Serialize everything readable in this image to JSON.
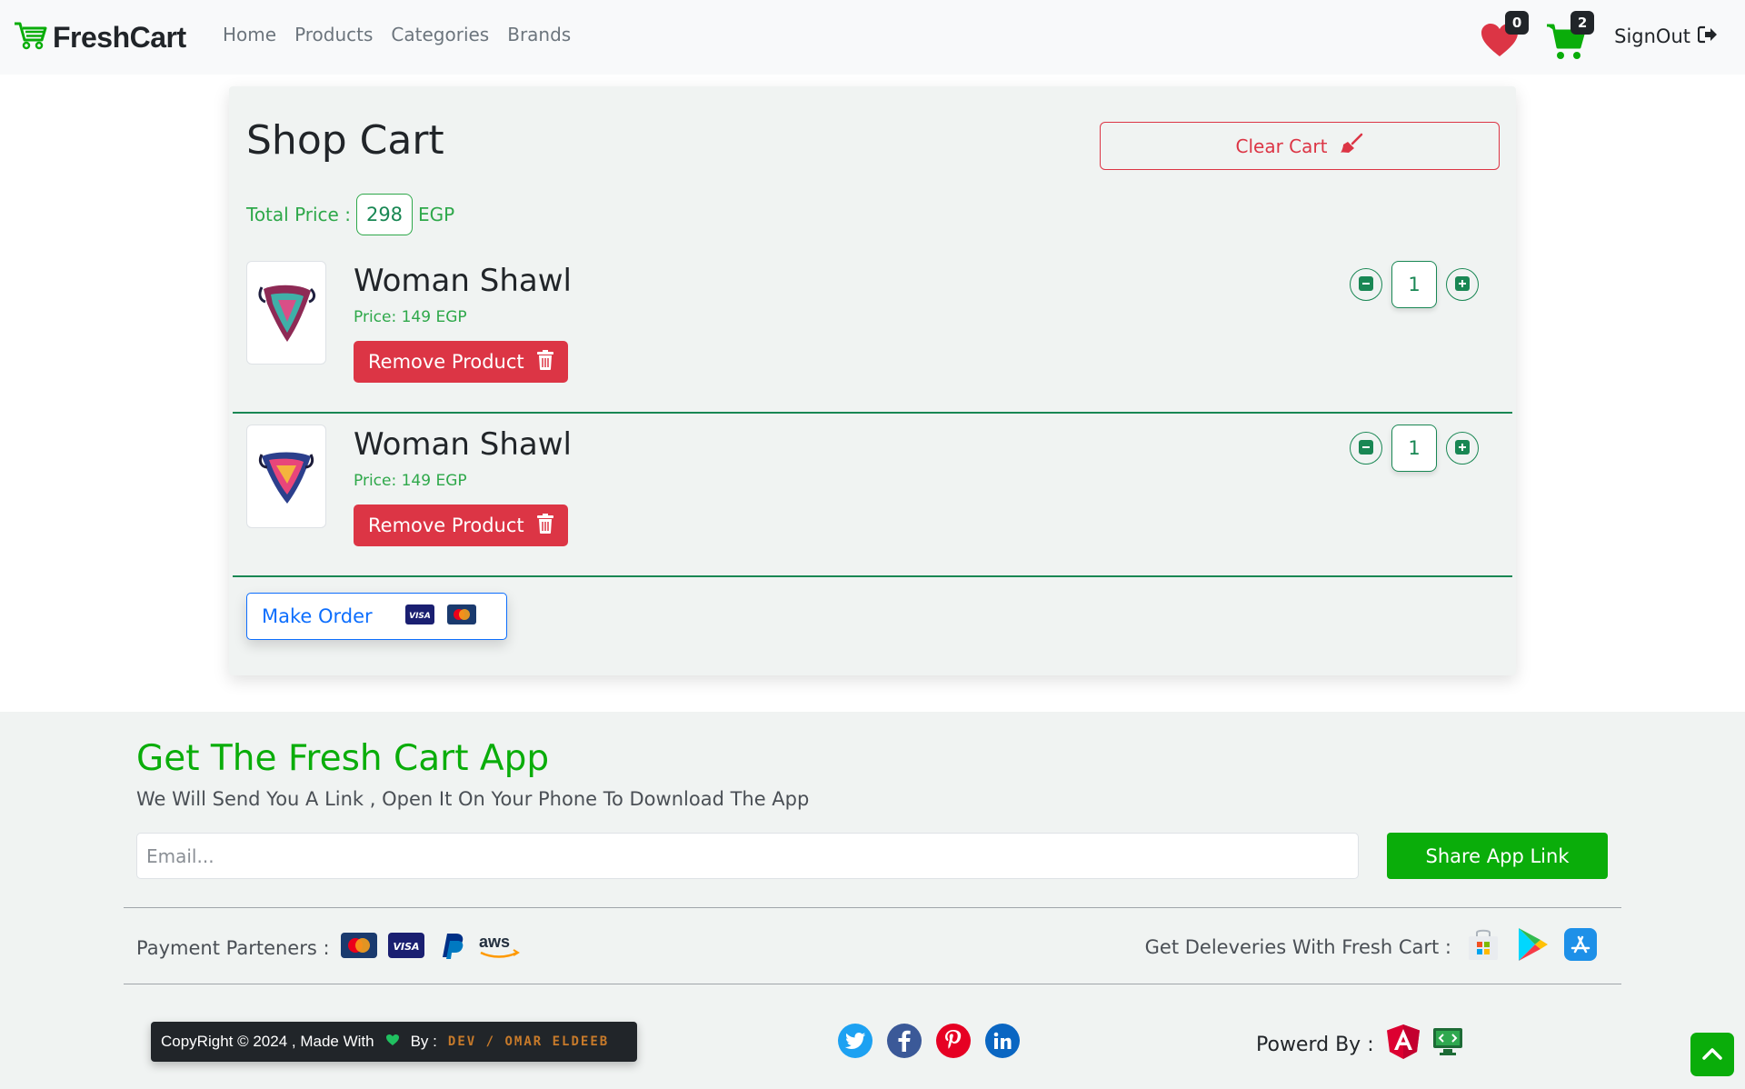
{
  "colors": {
    "brand_green": "#0aad0a",
    "cart_green": "#198754",
    "danger": "#dc3545",
    "primary": "#0d6efd",
    "wishlist_red": "#dc3545"
  },
  "navbar": {
    "brand": "FreshCart",
    "brand_icon": "shopping-cart-icon",
    "links": [
      "Home",
      "Products",
      "Categories",
      "Brands"
    ],
    "wishlist_count": "0",
    "cart_count": "2",
    "signout_label": "SignOut"
  },
  "cart": {
    "title": "Shop Cart",
    "clear_label": "Clear Cart",
    "total_label": "Total Price :",
    "total_value": "298",
    "currency": "EGP",
    "items": [
      {
        "name": "Woman Shawl",
        "price": "Price: 149 EGP",
        "remove_label": "Remove Product",
        "quantity": "1"
      },
      {
        "name": "Woman Shawl",
        "price": "Price: 149 EGP",
        "remove_label": "Remove Product",
        "quantity": "1"
      }
    ],
    "order_label": "Make Order"
  },
  "footer": {
    "title": "Get The Fresh Cart App",
    "subtitle": "We Will Send You A Link , Open It On Your Phone To Download The App",
    "email_placeholder": "Email...",
    "share_label": "Share App Link",
    "payment_label": "Payment Parteners :",
    "delivery_label": "Get Deleveries With Fresh Cart :",
    "copyright_text": "CopyRight © 2024 , Made With",
    "by_label": "By :",
    "dev_name": "DEV / OMAR ELDEEB",
    "powered_label": "Powerd By :"
  }
}
